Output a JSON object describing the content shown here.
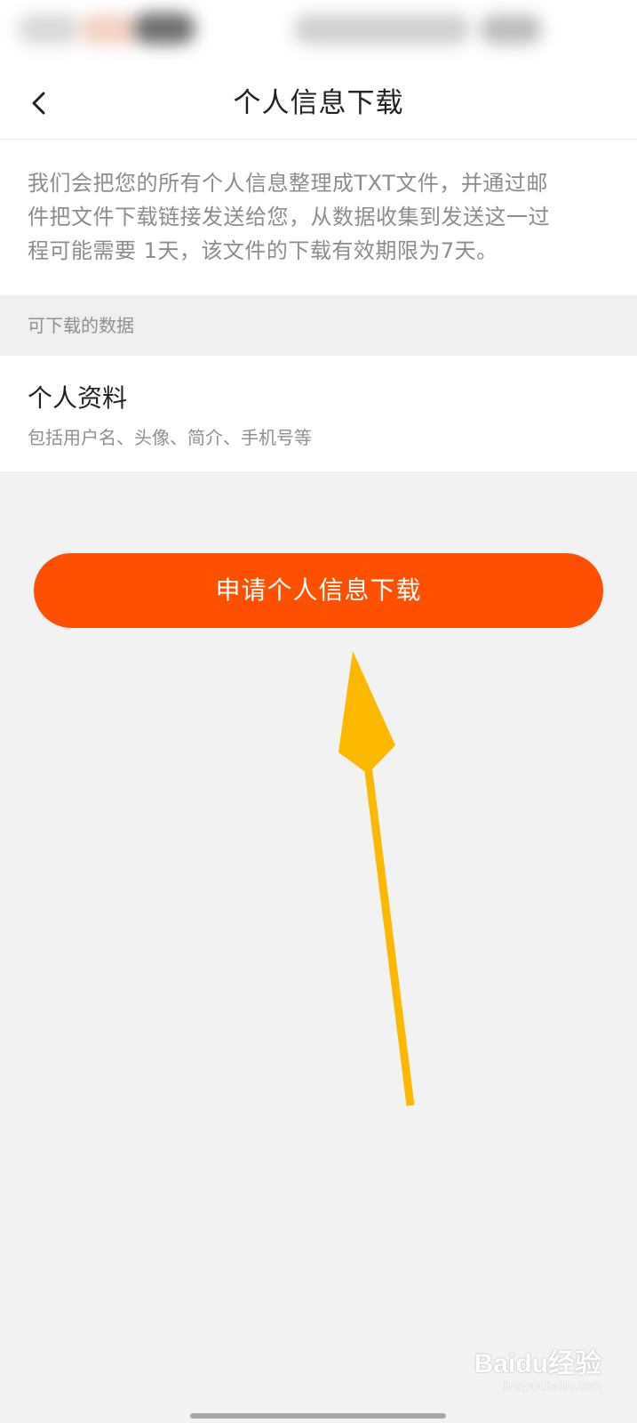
{
  "nav": {
    "title": "个人信息下载",
    "back_icon": "chevron-left-icon"
  },
  "description": {
    "lines": [
      "我们会把您的所有个人信息整理成TXT文件，并通过邮",
      "件把文件下载链接发送给您，从数据收集到发送这一过",
      "程可能需要 1天，该文件的下载有效期限为7天。"
    ]
  },
  "section": {
    "header": "可下载的数据"
  },
  "data_items": [
    {
      "title": "个人资料",
      "subtitle": "包括用户名、头像、简介、手机号等"
    }
  ],
  "apply_button": {
    "label": "申请个人信息下载"
  },
  "watermark": {
    "brand": "Baidu经验",
    "url": "jingyan.baidu.com"
  },
  "colors": {
    "accent": "#ff5000",
    "annotation_arrow": "#ffb800",
    "background": "#f2f2f2"
  }
}
